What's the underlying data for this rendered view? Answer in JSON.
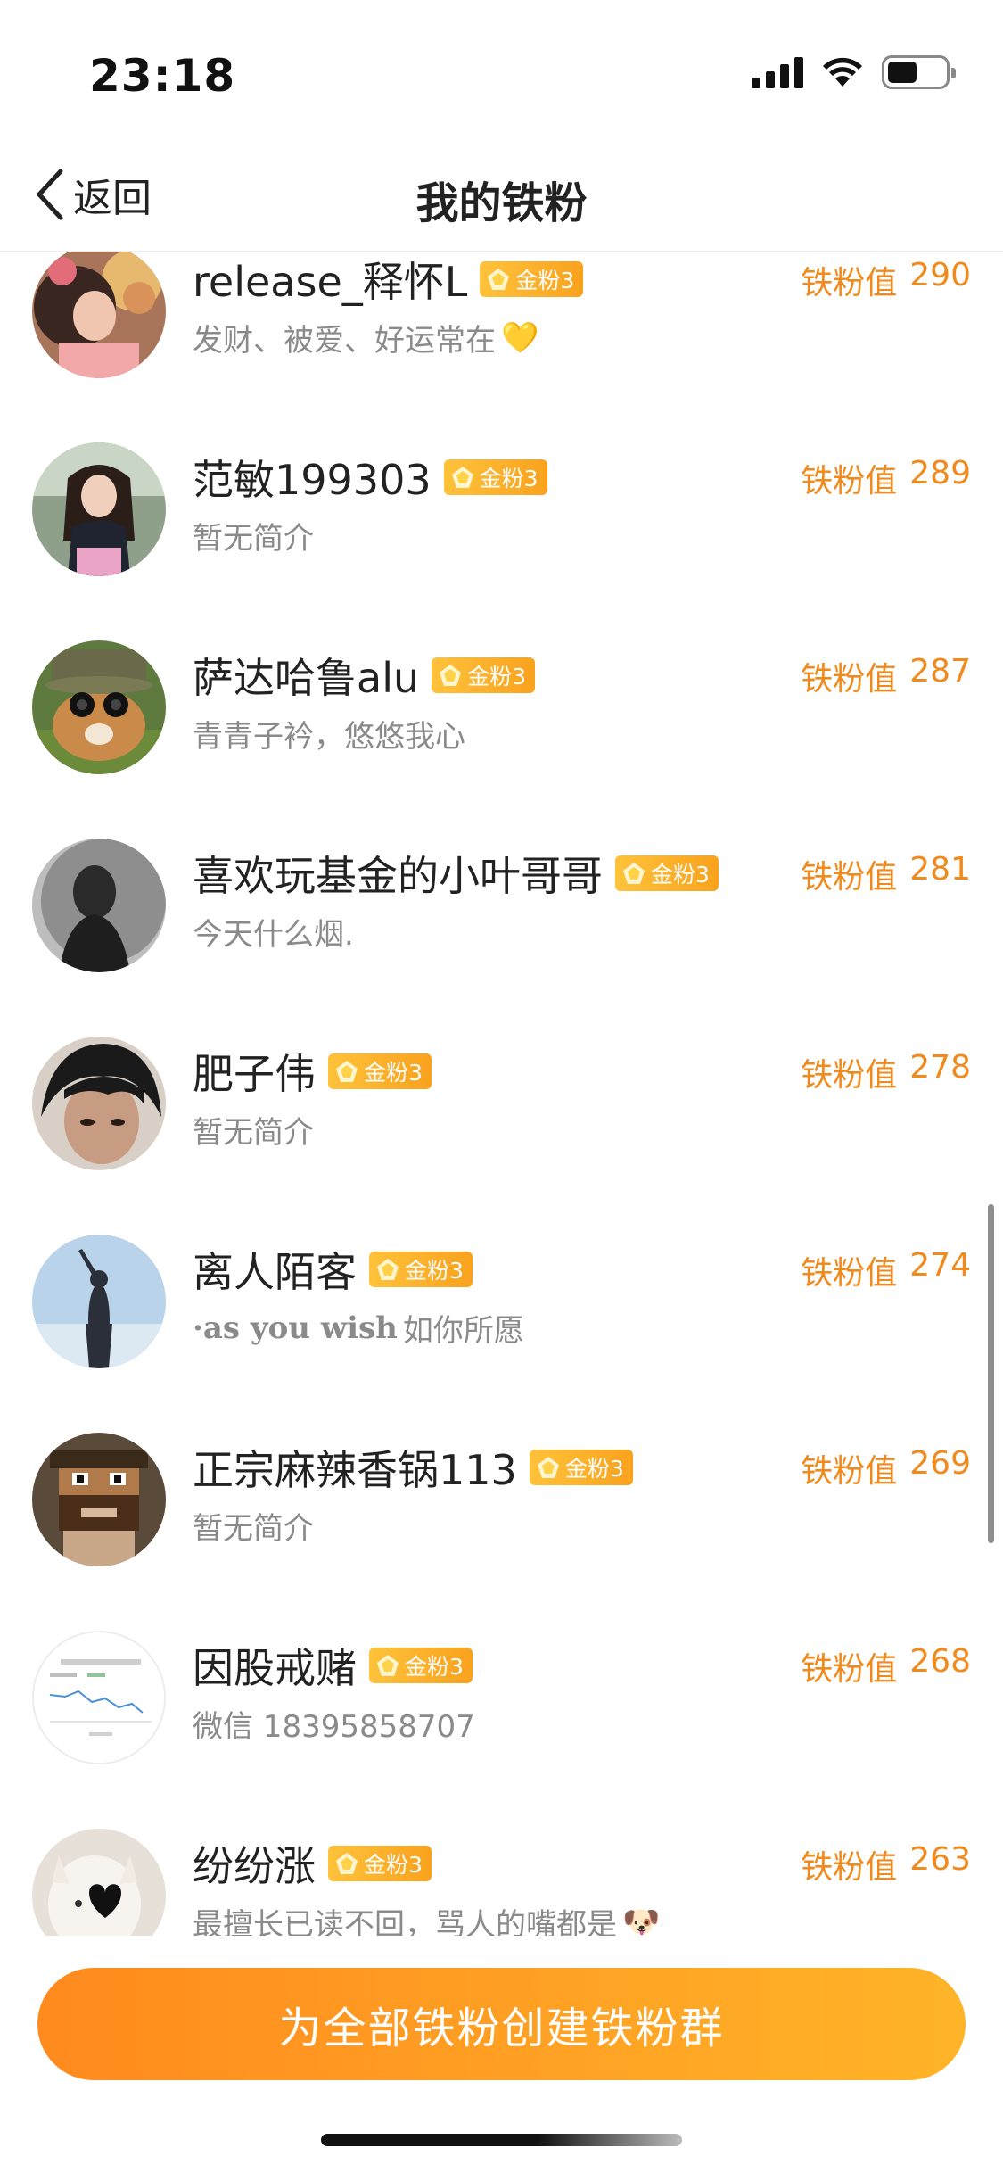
{
  "status_bar": {
    "time": "23:18"
  },
  "nav": {
    "back_label": "返回",
    "title": "我的铁粉"
  },
  "score_label": "铁粉值",
  "fans": [
    {
      "name": "release_释怀L",
      "badge": "金粉3",
      "bio": "发财、被爱、好运常在",
      "bio_emoji": "💛",
      "score": "290"
    },
    {
      "name": "范敏199303",
      "badge": "金粉3",
      "bio": "暂无简介",
      "score": "289"
    },
    {
      "name": "萨达哈鲁alu",
      "badge": "金粉3",
      "bio": "青青子衿，悠悠我心",
      "score": "287"
    },
    {
      "name": "喜欢玩基金的小叶哥哥",
      "badge": "金粉3",
      "bio": "今天什么烟.",
      "score": "281"
    },
    {
      "name": "肥子伟",
      "badge": "金粉3",
      "bio": "暂无简介",
      "score": "278"
    },
    {
      "name": "离人陌客",
      "badge": "金粉3",
      "bio_serif": "·as you wish",
      "bio": "如你所愿",
      "score": "274"
    },
    {
      "name": "正宗麻辣香锅113",
      "badge": "金粉3",
      "bio": "暂无简介",
      "score": "269"
    },
    {
      "name": "因股戒赌",
      "badge": "金粉3",
      "bio": "微信 18395858707",
      "score": "268"
    },
    {
      "name": "纷纷涨",
      "badge": "金粉3",
      "bio": "最擅长已读不回，骂人的嘴都是",
      "bio_emoji": "🐶",
      "score": "263"
    }
  ],
  "bottom": {
    "button_label": "为全部铁粉创建铁粉群"
  },
  "colors": {
    "accent": "#f08a1c",
    "badge_gold": "#ffb12b",
    "button_start": "#ff8a1e",
    "button_end": "#ffb428"
  }
}
